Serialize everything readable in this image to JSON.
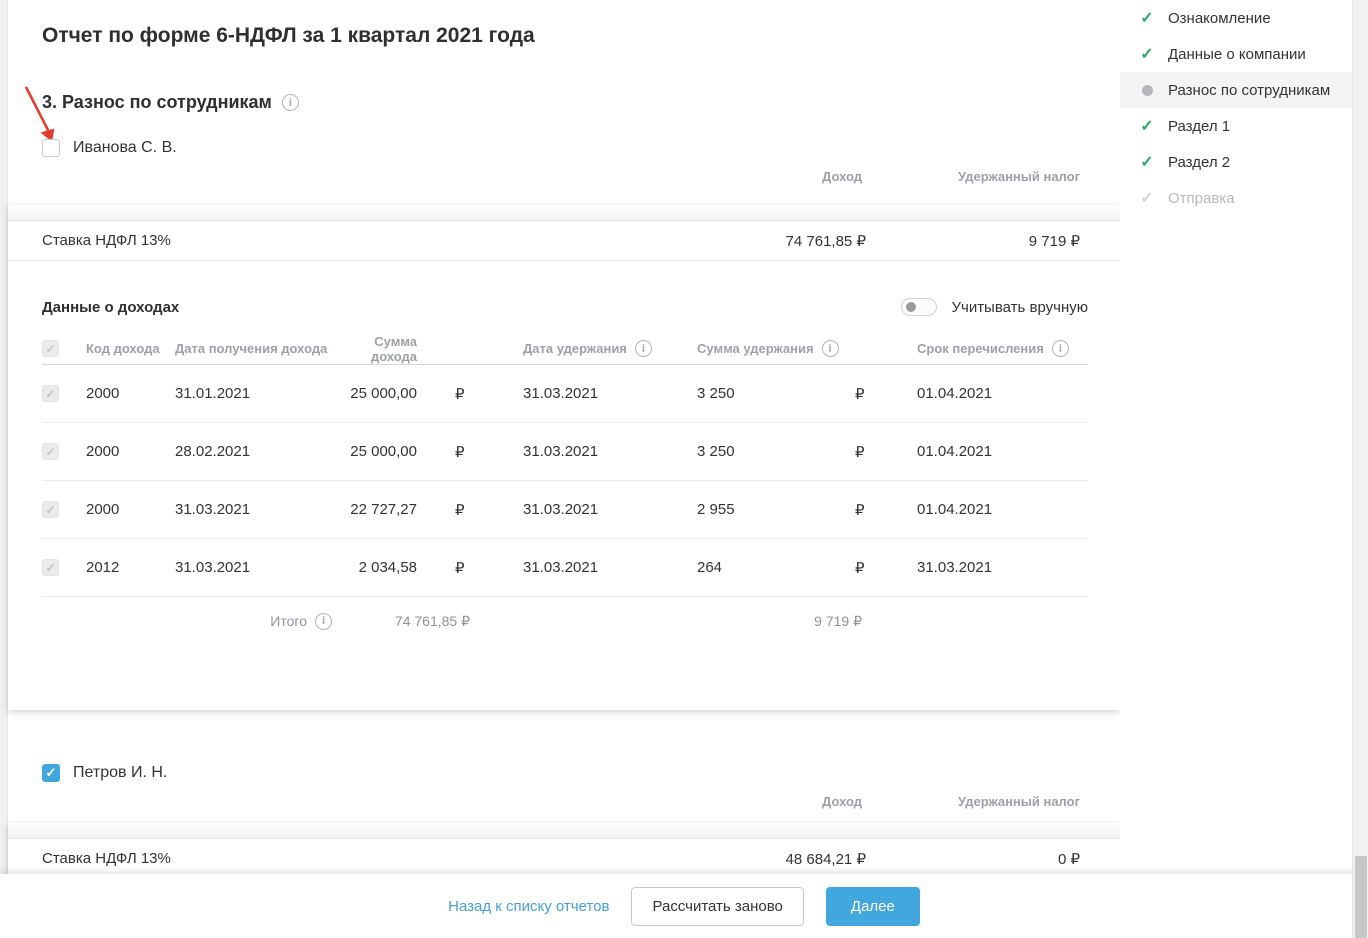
{
  "page": {
    "title": "Отчет по форме 6-НДФЛ за 1 квартал 2021 года",
    "section_title": "3. Разнос по сотрудникам"
  },
  "labels": {
    "income_col": "Доход",
    "tax_col": "Удержанный налог"
  },
  "sidebar": {
    "items": [
      {
        "label": "Ознакомление",
        "status": "done"
      },
      {
        "label": "Данные о компании",
        "status": "done"
      },
      {
        "label": "Разнос по сотрудникам",
        "status": "active"
      },
      {
        "label": "Раздел 1",
        "status": "done"
      },
      {
        "label": "Раздел 2",
        "status": "done"
      },
      {
        "label": "Отправка",
        "status": "disabled"
      }
    ]
  },
  "employees": [
    {
      "name": "Иванова С. В.",
      "checked": false,
      "rate_label": "Ставка НДФЛ 13%",
      "rate_income": "74 761,85 ₽",
      "rate_tax": "9 719 ₽",
      "income_block": {
        "title": "Данные о доходах",
        "toggle_label": "Учитывать вручную",
        "toggle_on": false,
        "headers": [
          "Код дохода",
          "Дата получения дохода",
          "Сумма дохода",
          "Дата удержания",
          "Сумма удержания",
          "Срок перечисления"
        ],
        "rows": [
          {
            "code": "2000",
            "receive_date": "31.01.2021",
            "income": "25 000,00",
            "income_cur": "₽",
            "withhold_date": "31.03.2021",
            "withhold": "3 250",
            "withhold_cur": "₽",
            "deadline": "01.04.2021"
          },
          {
            "code": "2000",
            "receive_date": "28.02.2021",
            "income": "25 000,00",
            "income_cur": "₽",
            "withhold_date": "31.03.2021",
            "withhold": "3 250",
            "withhold_cur": "₽",
            "deadline": "01.04.2021"
          },
          {
            "code": "2000",
            "receive_date": "31.03.2021",
            "income": "22 727,27",
            "income_cur": "₽",
            "withhold_date": "31.03.2021",
            "withhold": "2 955",
            "withhold_cur": "₽",
            "deadline": "01.04.2021"
          },
          {
            "code": "2012",
            "receive_date": "31.03.2021",
            "income": "2 034,58",
            "income_cur": "₽",
            "withhold_date": "31.03.2021",
            "withhold": "264",
            "withhold_cur": "₽",
            "deadline": "31.03.2021"
          }
        ],
        "total_label": "Итого",
        "total_income": "74 761,85 ₽",
        "total_tax": "9 719 ₽"
      }
    },
    {
      "name": "Петров И. Н.",
      "checked": true,
      "rate_label": "Ставка НДФЛ 13%",
      "rate_income": "48 684,21 ₽",
      "rate_tax": "0 ₽"
    }
  ],
  "footer": {
    "back_link": "Назад к списку отчетов",
    "recalc_button": "Рассчитать заново",
    "next_button": "Далее"
  },
  "colors": {
    "accent_blue": "#41a7de",
    "link_blue": "#459fd6",
    "check_green": "#2dab66",
    "annotation_red": "#e23d2e"
  }
}
